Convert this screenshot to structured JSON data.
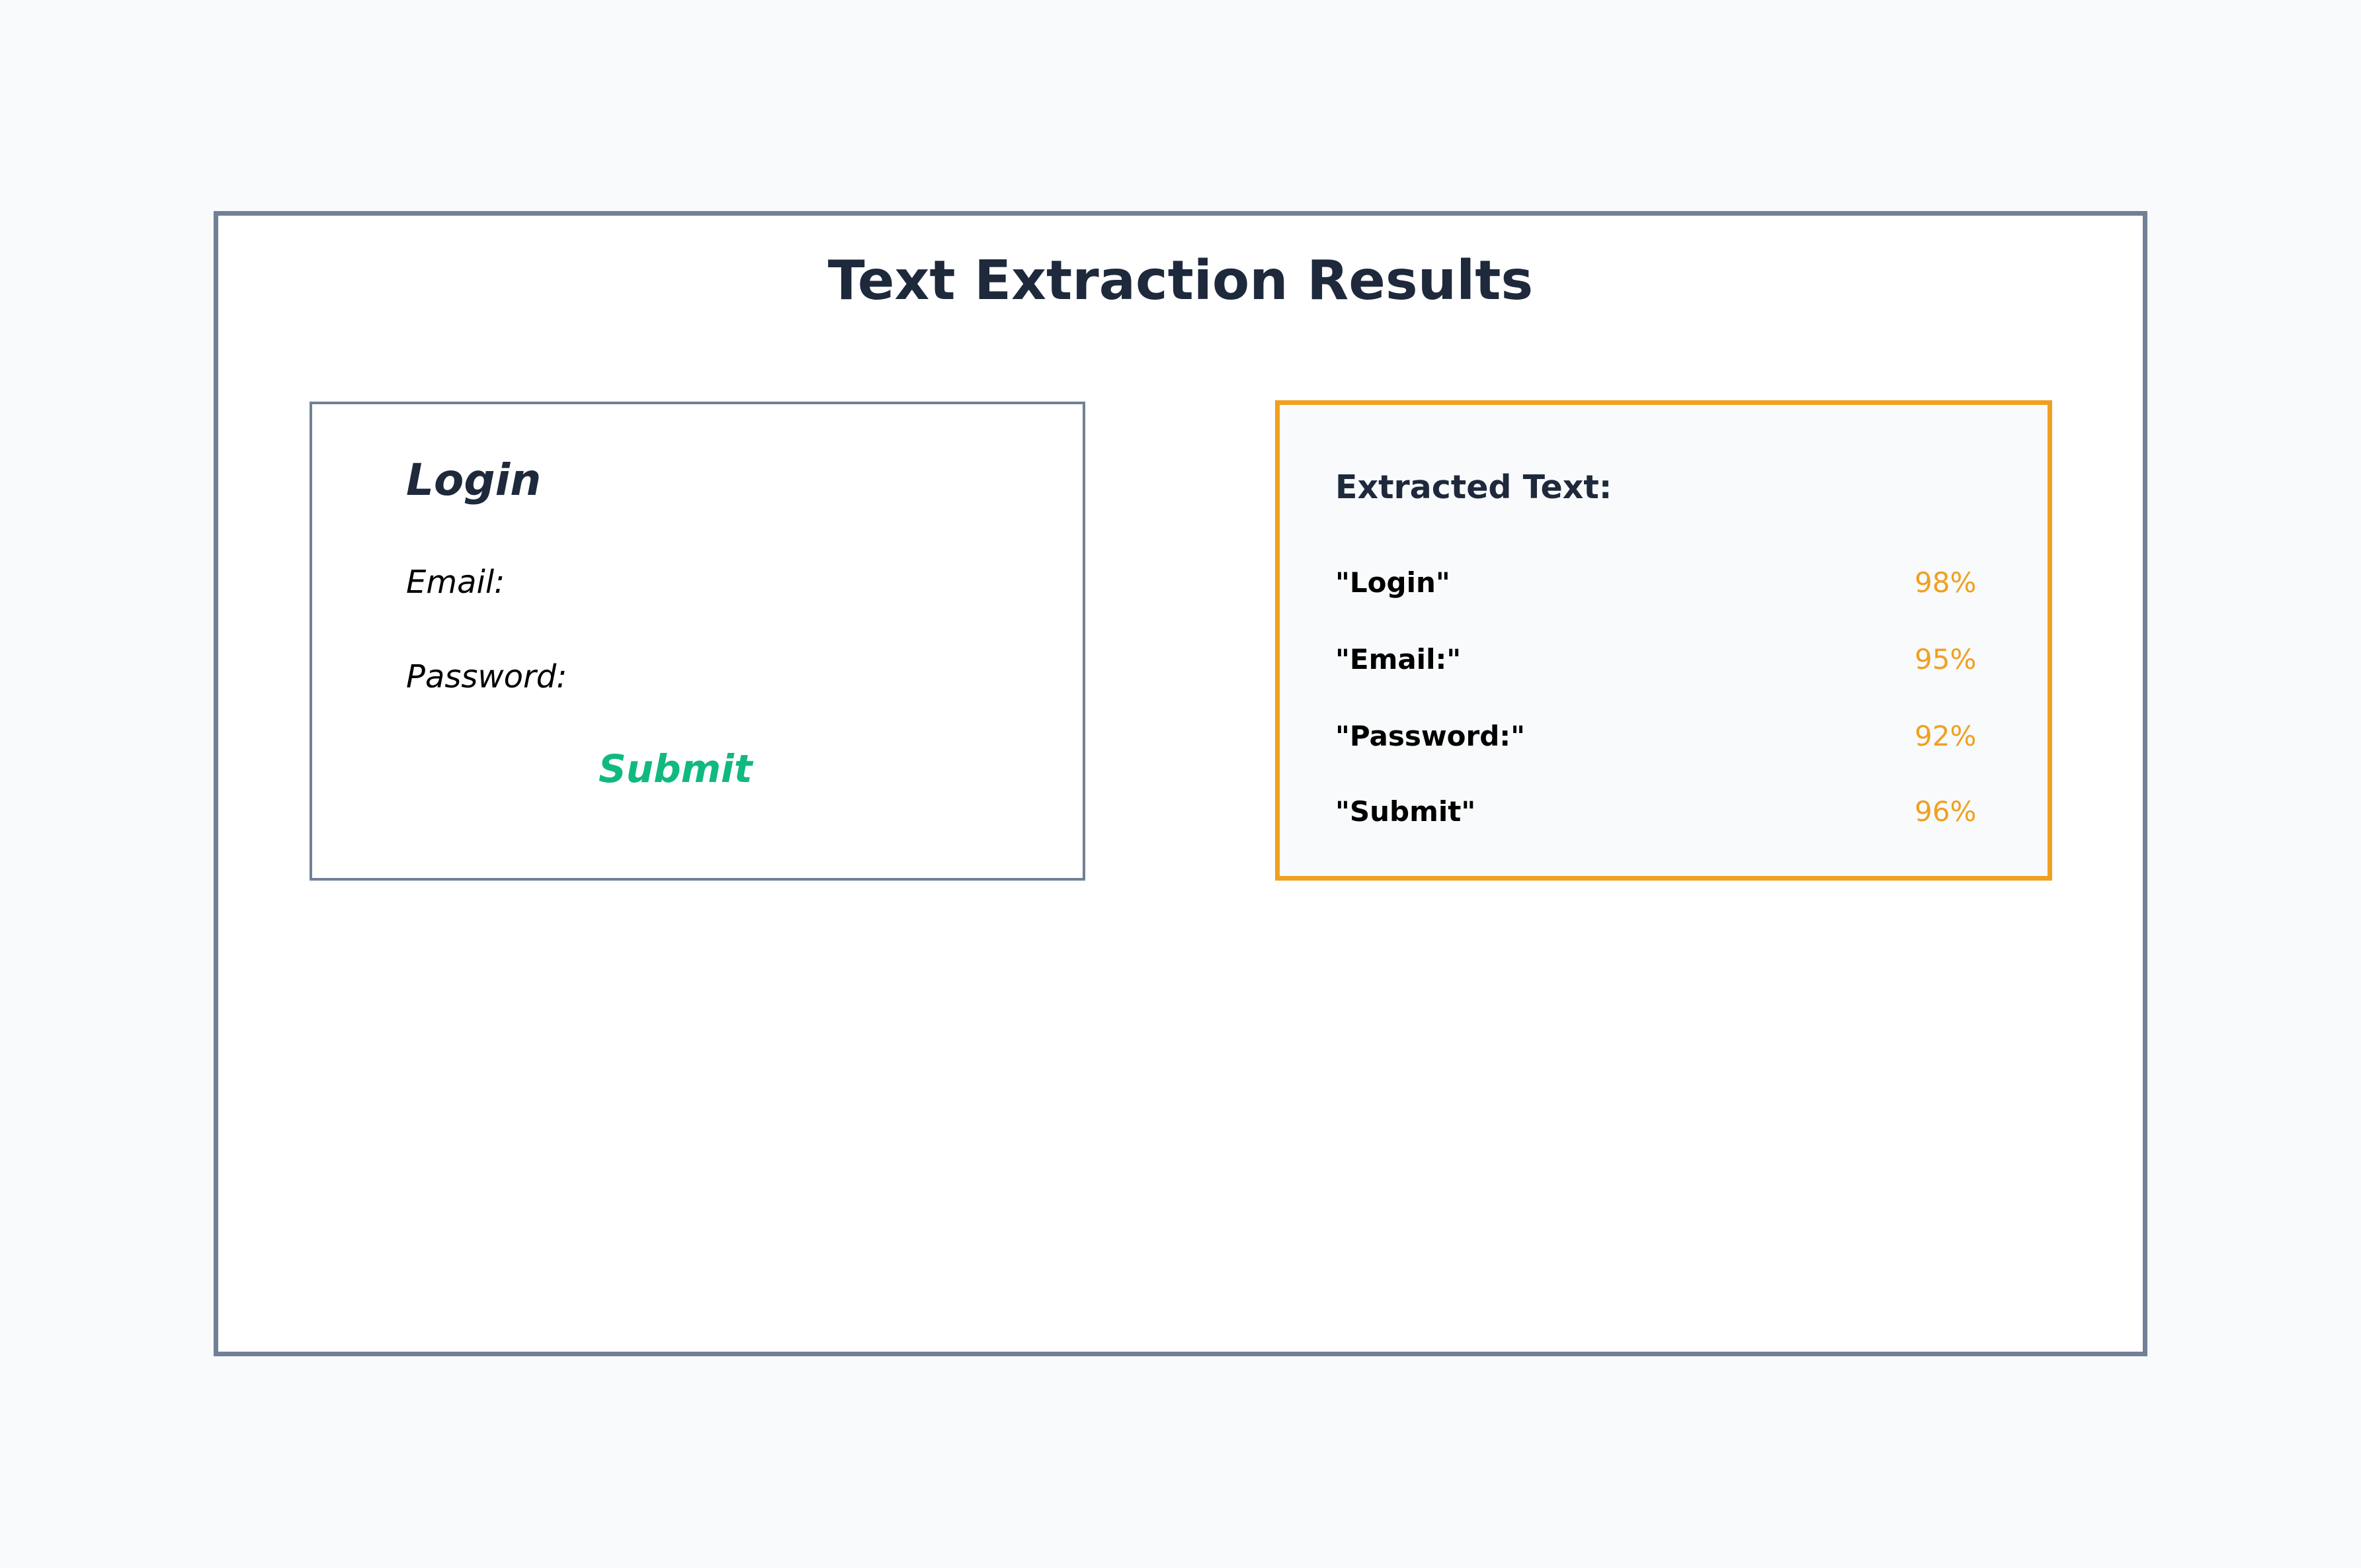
{
  "title": "Text Extraction Results",
  "source_ui": {
    "heading": "Login",
    "email_label": "Email:",
    "password_label": "Password:",
    "submit_label": "Submit"
  },
  "extraction": {
    "heading": "Extracted Text:",
    "items": [
      {
        "text": "\"Login\"",
        "confidence": "98%"
      },
      {
        "text": "\"Email:\"",
        "confidence": "95%"
      },
      {
        "text": "\"Password:\"",
        "confidence": "92%"
      },
      {
        "text": "\"Submit\"",
        "confidence": "96%"
      }
    ]
  },
  "colors": {
    "frame_border": "#718096",
    "result_border": "#f0a020",
    "confidence_text": "#f0a020",
    "submit_text": "#10b981",
    "heading_text": "#1e293b",
    "background": "#f8fafc"
  }
}
